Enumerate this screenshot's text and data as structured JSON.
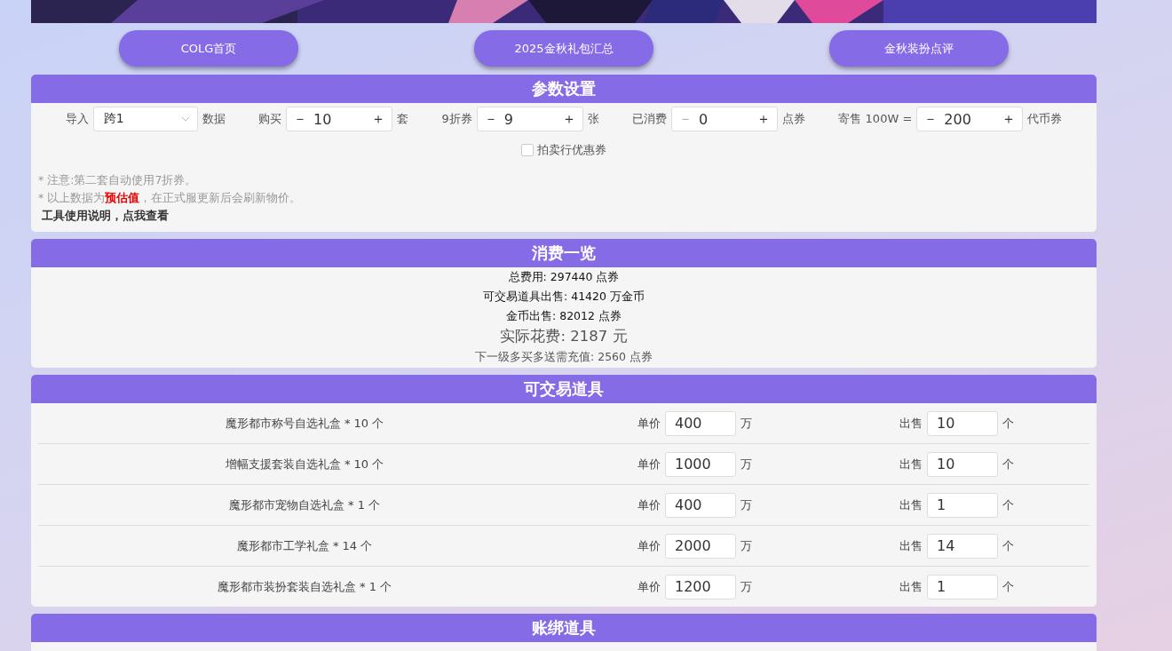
{
  "banner": {
    "kind": "picture"
  },
  "nav_buttons": [
    "COLG首页",
    "2025金秋礼包汇总",
    "金秋装扮点评"
  ],
  "settings": {
    "title": "参数设置",
    "import": {
      "label": "导入",
      "value": "跨1",
      "suffix": "数据"
    },
    "steppers": [
      {
        "label": "购买",
        "minus": "－",
        "value": "10",
        "plus": "＋",
        "unit": "套"
      },
      {
        "label": "9折券",
        "minus": "－",
        "value": "9",
        "plus": "＋",
        "unit": "张"
      },
      {
        "label": "已消费",
        "minus": "－",
        "value": "0",
        "plus": "＋",
        "unit": "点券",
        "minus_disabled": true
      },
      {
        "label": "寄售 100W =",
        "minus": "－",
        "value": "200",
        "plus": "＋",
        "unit": "代币券"
      }
    ],
    "auction_coupon": {
      "label": "拍卖行优惠券",
      "checked": false
    },
    "notes": [
      "* 注意:第二套自动使用7折券。",
      "* 以上数据为**预估值**，在正式服更新后会刷新物价。"
    ],
    "help_link": "工具使用说明，点我查看"
  },
  "summary": {
    "title": "消费一览",
    "lines": [
      "总费用: 297440 点券",
      "可交易道具出售: 41420 万金币",
      "金币出售: 82012 点券"
    ],
    "actual_cost": "实际花费: 2187 元",
    "next_level": "下一级多买多送需充值: 2560 点券"
  },
  "tradable": {
    "title": "可交易道具",
    "rows": [
      {
        "name": "魔形都市称号自选礼盒 * 10 个",
        "price_label": "单价",
        "price": "400",
        "price_unit": "万",
        "sell_label": "出售",
        "sell": "10",
        "sell_unit": "个"
      },
      {
        "name": "增幅支援套装自选礼盒 * 10 个",
        "price_label": "单价",
        "price": "1000",
        "price_unit": "万",
        "sell_label": "出售",
        "sell": "10",
        "sell_unit": "个"
      },
      {
        "name": "魔形都市宠物自选礼盒 * 1 个",
        "price_label": "单价",
        "price": "400",
        "price_unit": "万",
        "sell_label": "出售",
        "sell": "1",
        "sell_unit": "个"
      },
      {
        "name": "魔形都市工学礼盒 * 14 个",
        "price_label": "单价",
        "price": "2000",
        "price_unit": "万",
        "sell_label": "出售",
        "sell": "14",
        "sell_unit": "个"
      },
      {
        "name": "魔形都市装扮套装自选礼盒 * 1 个",
        "price_label": "单价",
        "price": "1200",
        "price_unit": "万",
        "sell_label": "出售",
        "sell": "1",
        "sell_unit": "个"
      }
    ]
  },
  "bound": {
    "title": "账绑道具"
  }
}
